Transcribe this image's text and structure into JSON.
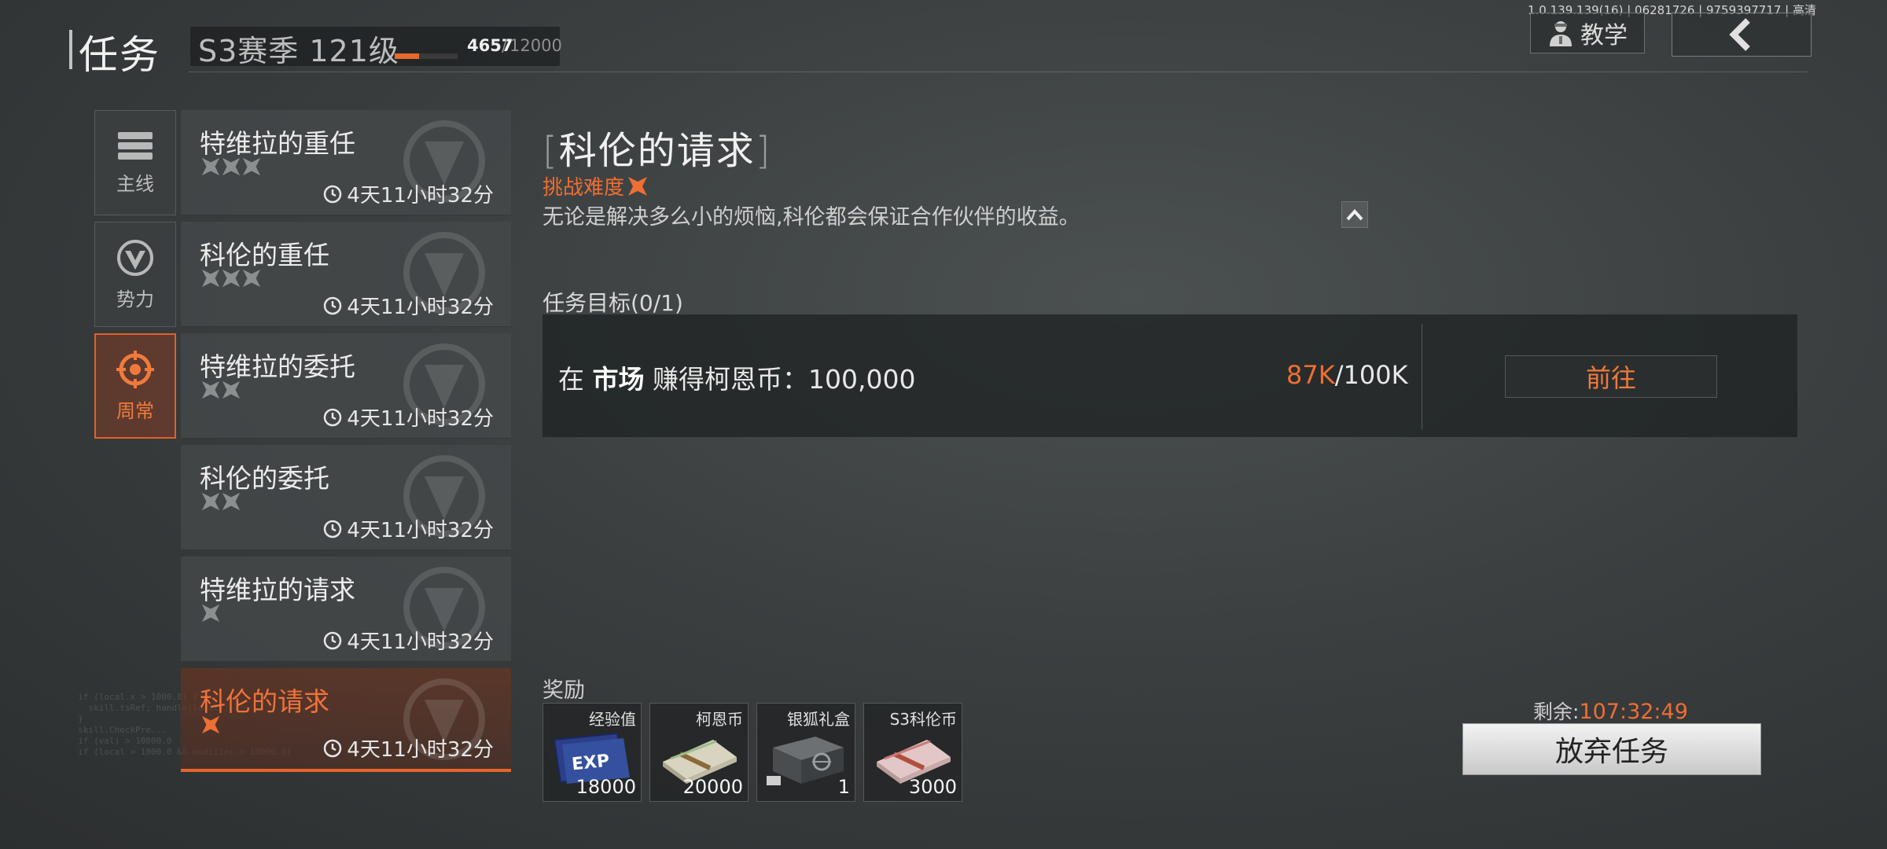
{
  "version_info": "1.0.139.139(16) | 06281726 | 9759397717 | 高清",
  "header": {
    "title": "任务",
    "season_label": "S3赛季 121级",
    "xp_current": "4657",
    "xp_max": "12000",
    "xp_sep": "/",
    "xp_fraction": 0.388,
    "tutorial_label": "教学"
  },
  "categories": [
    {
      "label": "主线",
      "icon": "list-icon",
      "active": false
    },
    {
      "label": "势力",
      "icon": "faction-icon",
      "active": false
    },
    {
      "label": "周常",
      "icon": "crosshair-icon",
      "active": true
    }
  ],
  "quests": [
    {
      "name": "特维拉的重任",
      "stars": 3,
      "time": "4天11小时32分",
      "active": false
    },
    {
      "name": "科伦的重任",
      "stars": 3,
      "time": "4天11小时32分",
      "active": false
    },
    {
      "name": "特维拉的委托",
      "stars": 2,
      "time": "4天11小时32分",
      "active": false
    },
    {
      "name": "科伦的委托",
      "stars": 2,
      "time": "4天11小时32分",
      "active": false
    },
    {
      "name": "特维拉的请求",
      "stars": 1,
      "time": "4天11小时32分",
      "active": false
    },
    {
      "name": "科伦的请求",
      "stars": 1,
      "time": "4天11小时32分",
      "active": true
    }
  ],
  "detail": {
    "bracket_open": "[",
    "title": "科伦的请求",
    "bracket_close": "]",
    "difficulty_label": "挑战难度",
    "description": "无论是解决多么小的烦恼,科伦都会保证合作伙伴的收益。",
    "objective_label": "任务目标(0/1)",
    "objective_prefix": "在",
    "objective_place": "市场",
    "objective_rest": "赚得柯恩币：100,000",
    "progress_current": "87K",
    "progress_sep": "/",
    "progress_target": "100K",
    "goto_label": "前往"
  },
  "rewards": {
    "label": "奖励",
    "items": [
      {
        "name": "经验值",
        "qty": "18000",
        "icon": "exp-ticket-icon"
      },
      {
        "name": "柯恩币",
        "qty": "20000",
        "icon": "cash-stack-icon"
      },
      {
        "name": "银狐礼盒",
        "qty": "1",
        "icon": "gift-box-icon"
      },
      {
        "name": "S3科伦币",
        "qty": "3000",
        "icon": "s3-cash-stack-icon"
      }
    ]
  },
  "remaining_label": "剩余:",
  "remaining_time": "107:32:49",
  "abandon_label": "放弃任务",
  "colors": {
    "accent": "#ee6e33",
    "background": "#3b3f40",
    "panel": "#1e2122"
  }
}
